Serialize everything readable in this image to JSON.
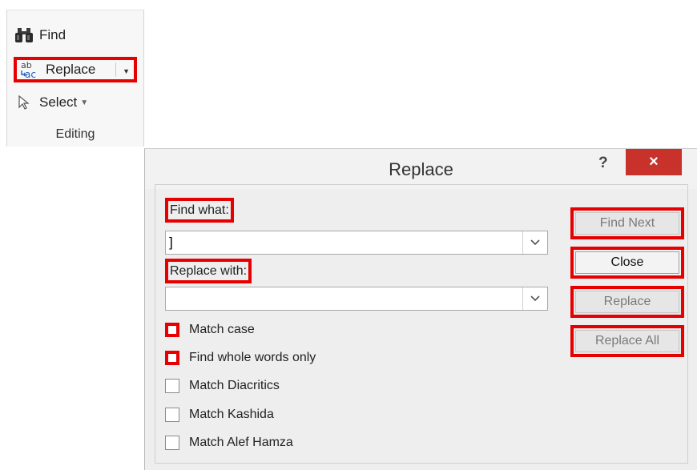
{
  "ribbon": {
    "find_label": "Find",
    "replace_label": "Replace",
    "select_label": "Select",
    "group_label": "Editing"
  },
  "dialog": {
    "title": "Replace",
    "help_label": "?",
    "close_glyph": "×",
    "find_what_label": "Find what:",
    "find_what_value": "]",
    "replace_with_label": "Replace with:",
    "replace_with_value": "",
    "options": [
      {
        "label": "Match case",
        "checked": false,
        "highlighted": true
      },
      {
        "label": "Find whole words only",
        "checked": false,
        "highlighted": true
      },
      {
        "label": "Match Diacritics",
        "checked": false,
        "highlighted": false
      },
      {
        "label": "Match Kashida",
        "checked": false,
        "highlighted": false
      },
      {
        "label": "Match Alef Hamza",
        "checked": false,
        "highlighted": false
      }
    ],
    "buttons": {
      "find_next": "Find Next",
      "close": "Close",
      "replace": "Replace",
      "replace_all": "Replace All"
    }
  },
  "colors": {
    "highlight": "#e60000",
    "close_button": "#c9312b"
  }
}
